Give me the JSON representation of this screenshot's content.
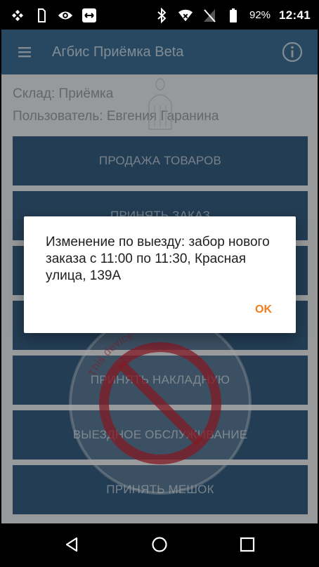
{
  "status_bar": {
    "battery_percent": "92%",
    "clock": "12:41",
    "icons_left": [
      "signal-off-icon",
      "sim-icon",
      "eye-icon",
      "remote-icon"
    ],
    "icons_right": [
      "bluetooth-icon",
      "wifi-icon",
      "no-sim-icon",
      "battery-icon"
    ]
  },
  "app_bar": {
    "title": "Агбис Приёмка Beta",
    "menu_icon": "hamburger-icon",
    "info_icon": "info-icon"
  },
  "info": {
    "warehouse": "Склад: Приёмка",
    "user": "Пользователь: Евгения Гаранина"
  },
  "menu_buttons": [
    {
      "label": "ПРОДАЖА ТОВАРОВ"
    },
    {
      "label": "ПРИНЯТЬ ЗАКАЗ"
    },
    {
      "label": ""
    },
    {
      "label": ""
    },
    {
      "label": "ПРИНЯТЬ НАКЛАДНУЮ"
    },
    {
      "label": "ВЫЕЗДНОЕ ОБСЛУЖИВАНИЕ"
    },
    {
      "label": "ПРИНЯТЬ МЕШОК"
    }
  ],
  "watermark": {
    "text_top": "This device",
    "text_right": "...on",
    "text_left": "t (...) I"
  },
  "dialog": {
    "message": "Изменение по выезду: забор нового заказа с 11:00 по 11:30, Красная улица, 139А",
    "ok_label": "OK"
  },
  "nav_bar": {
    "icons": [
      "back-icon",
      "home-icon",
      "recents-icon"
    ]
  },
  "colors": {
    "primary": "#3c6f94",
    "button": "#375f82",
    "accent": "#f07d1b",
    "watermark": "#c8283a"
  }
}
